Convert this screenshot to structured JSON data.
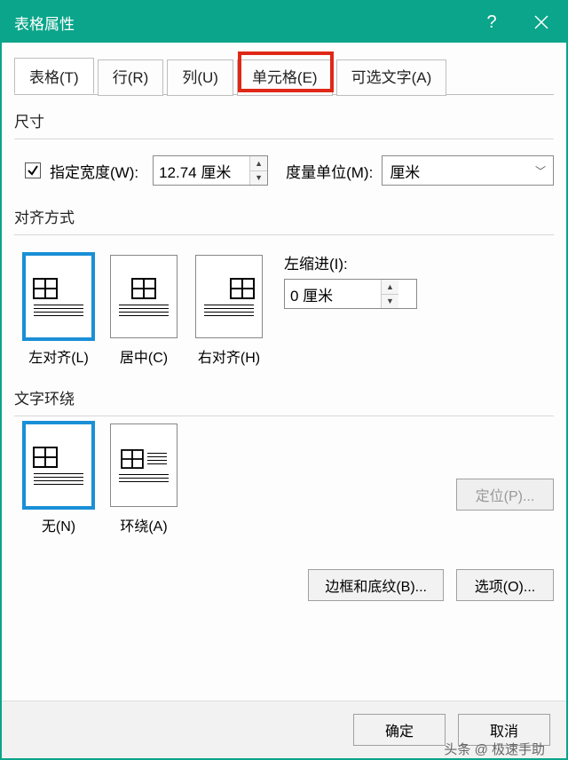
{
  "title": "表格属性",
  "tabs": {
    "table": "表格(T)",
    "row": "行(R)",
    "column": "列(U)",
    "cell": "单元格(E)",
    "alttext": "可选文字(A)"
  },
  "size": {
    "section_label": "尺寸",
    "pref_width_label": "指定宽度(W):",
    "pref_width_value": "12.74 厘米",
    "pref_width_checked": true,
    "measure_label": "度量单位(M):",
    "measure_value": "厘米"
  },
  "align": {
    "section_label": "对齐方式",
    "left": "左对齐(L)",
    "center": "居中(C)",
    "right": "右对齐(H)",
    "indent_label": "左缩进(I):",
    "indent_value": "0 厘米"
  },
  "wrap": {
    "section_label": "文字环绕",
    "none": "无(N)",
    "around": "环绕(A)",
    "positioning_btn": "定位(P)..."
  },
  "bottom_buttons": {
    "borders": "边框和底纹(B)...",
    "options": "选项(O)..."
  },
  "footer": {
    "ok": "确定",
    "cancel": "取消"
  },
  "watermark": "头条 @ 极速手助"
}
